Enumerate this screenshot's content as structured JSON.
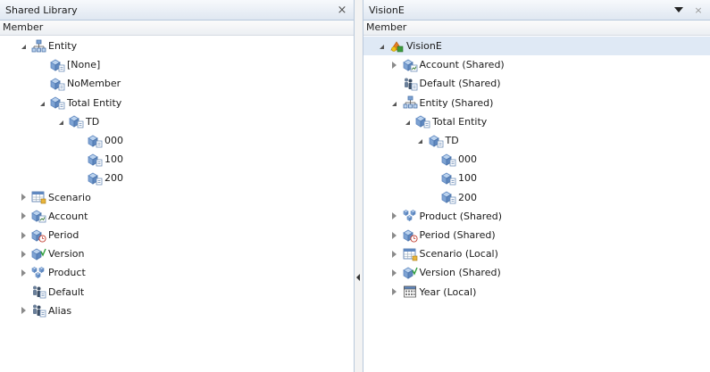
{
  "left": {
    "title": "Shared Library",
    "close_label": "×",
    "column_header": "Member",
    "rows": [
      {
        "label": "Entity",
        "icon": "hierarchy-icon",
        "depth": 0,
        "state": "expanded"
      },
      {
        "label": "[None]",
        "icon": "member-icon",
        "depth": 1,
        "state": "none"
      },
      {
        "label": "NoMember",
        "icon": "member-icon",
        "depth": 1,
        "state": "none"
      },
      {
        "label": "Total Entity",
        "icon": "member-icon",
        "depth": 1,
        "state": "expanded"
      },
      {
        "label": "TD",
        "icon": "member-icon",
        "depth": 2,
        "state": "expanded"
      },
      {
        "label": "000",
        "icon": "member-icon",
        "depth": 3,
        "state": "none"
      },
      {
        "label": "100",
        "icon": "member-icon",
        "depth": 3,
        "state": "none"
      },
      {
        "label": "200",
        "icon": "member-icon",
        "depth": 3,
        "state": "none"
      },
      {
        "label": "Scenario",
        "icon": "scenario-icon",
        "depth": 0,
        "state": "collapsed"
      },
      {
        "label": "Account",
        "icon": "account-icon",
        "depth": 0,
        "state": "collapsed"
      },
      {
        "label": "Period",
        "icon": "period-icon",
        "depth": 0,
        "state": "collapsed"
      },
      {
        "label": "Version",
        "icon": "version-icon",
        "depth": 0,
        "state": "collapsed"
      },
      {
        "label": "Product",
        "icon": "product-icon",
        "depth": 0,
        "state": "collapsed"
      },
      {
        "label": "Default",
        "icon": "people-icon",
        "depth": 0,
        "state": "none"
      },
      {
        "label": "Alias",
        "icon": "people-icon",
        "depth": 0,
        "state": "collapsed"
      }
    ]
  },
  "right": {
    "title": "VisionE",
    "close_label": "×",
    "column_header": "Member",
    "rows": [
      {
        "label": "VisionE",
        "icon": "application-icon",
        "depth": 0,
        "state": "expanded",
        "selected": true
      },
      {
        "label": "Account (Shared)",
        "icon": "account-icon",
        "depth": 1,
        "state": "collapsed"
      },
      {
        "label": "Default (Shared)",
        "icon": "people-icon",
        "depth": 1,
        "state": "none"
      },
      {
        "label": "Entity (Shared)",
        "icon": "hierarchy-icon",
        "depth": 1,
        "state": "expanded"
      },
      {
        "label": "Total Entity",
        "icon": "member-icon",
        "depth": 2,
        "state": "expanded"
      },
      {
        "label": "TD",
        "icon": "member-icon",
        "depth": 3,
        "state": "expanded"
      },
      {
        "label": "000",
        "icon": "member-icon",
        "depth": 4,
        "state": "none"
      },
      {
        "label": "100",
        "icon": "member-icon",
        "depth": 4,
        "state": "none"
      },
      {
        "label": "200",
        "icon": "member-icon",
        "depth": 4,
        "state": "none"
      },
      {
        "label": "Product (Shared)",
        "icon": "product-icon",
        "depth": 1,
        "state": "collapsed"
      },
      {
        "label": "Period (Shared)",
        "icon": "period-icon",
        "depth": 1,
        "state": "collapsed"
      },
      {
        "label": "Scenario (Local)",
        "icon": "scenario-icon",
        "depth": 1,
        "state": "collapsed"
      },
      {
        "label": "Version (Shared)",
        "icon": "version-icon",
        "depth": 1,
        "state": "collapsed"
      },
      {
        "label": "Year (Local)",
        "icon": "year-icon",
        "depth": 1,
        "state": "collapsed"
      }
    ]
  },
  "colors": {
    "header_border": "#b9c9dc",
    "selection": "#dfe9f5",
    "cube_blue": "#5f88c0",
    "cube_light": "#bcd3ee"
  }
}
